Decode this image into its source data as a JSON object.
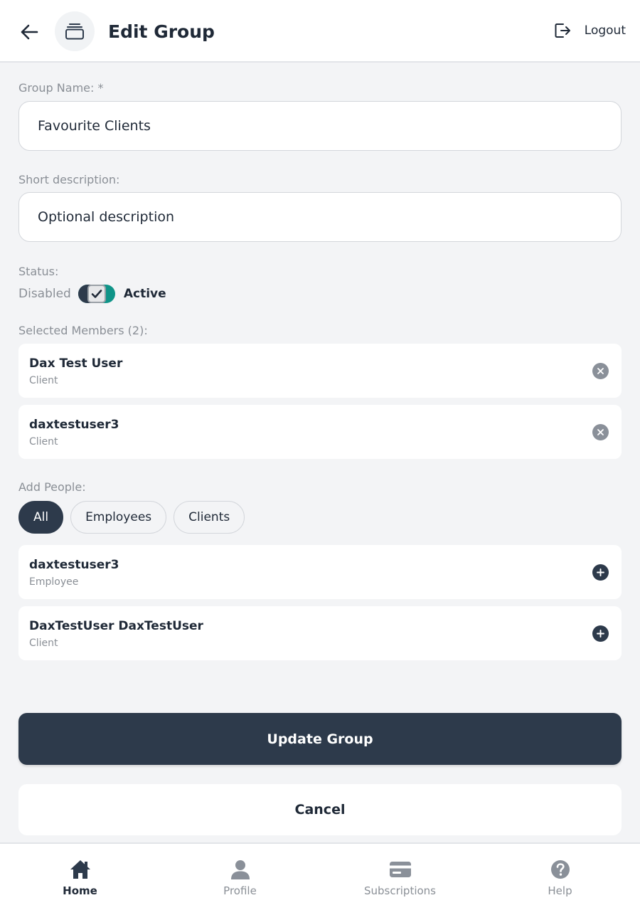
{
  "header": {
    "title": "Edit Group",
    "logout_label": "Logout",
    "icons": {
      "back": "arrow-left-icon",
      "group": "stacked-layers-icon",
      "logout": "logout-icon"
    }
  },
  "form": {
    "group_name": {
      "label": "Group Name: *",
      "value": "Favourite Clients"
    },
    "description": {
      "label": "Short description:",
      "placeholder": "Optional description"
    },
    "status": {
      "label": "Status:",
      "off_label": "Disabled",
      "on_label": "Active",
      "enabled": true
    }
  },
  "selected_members": {
    "label": "Selected Members (2):",
    "items": [
      {
        "name": "Dax Test User",
        "role": "Client"
      },
      {
        "name": "daxtestuser3",
        "role": "Client"
      }
    ]
  },
  "add_people": {
    "label": "Add People:",
    "filters": [
      {
        "label": "All",
        "active": true
      },
      {
        "label": "Employees",
        "active": false
      },
      {
        "label": "Clients",
        "active": false
      }
    ],
    "items": [
      {
        "name": "daxtestuser3",
        "role": "Employee"
      },
      {
        "name": "DaxTestUser DaxTestUser",
        "role": "Client"
      }
    ]
  },
  "actions": {
    "update_label": "Update Group",
    "cancel_label": "Cancel"
  },
  "bottom_nav": {
    "items": [
      {
        "label": "Home",
        "icon": "home-icon",
        "active": true
      },
      {
        "label": "Profile",
        "icon": "user-icon",
        "active": false
      },
      {
        "label": "Subscriptions",
        "icon": "credit-card-icon",
        "active": false
      },
      {
        "label": "Help",
        "icon": "help-circle-icon",
        "active": false
      }
    ]
  },
  "colors": {
    "primary": "#2d3a4b",
    "toggle_on": "#0f9488",
    "background": "#f3f4f6",
    "muted_text": "#8a8f96"
  }
}
